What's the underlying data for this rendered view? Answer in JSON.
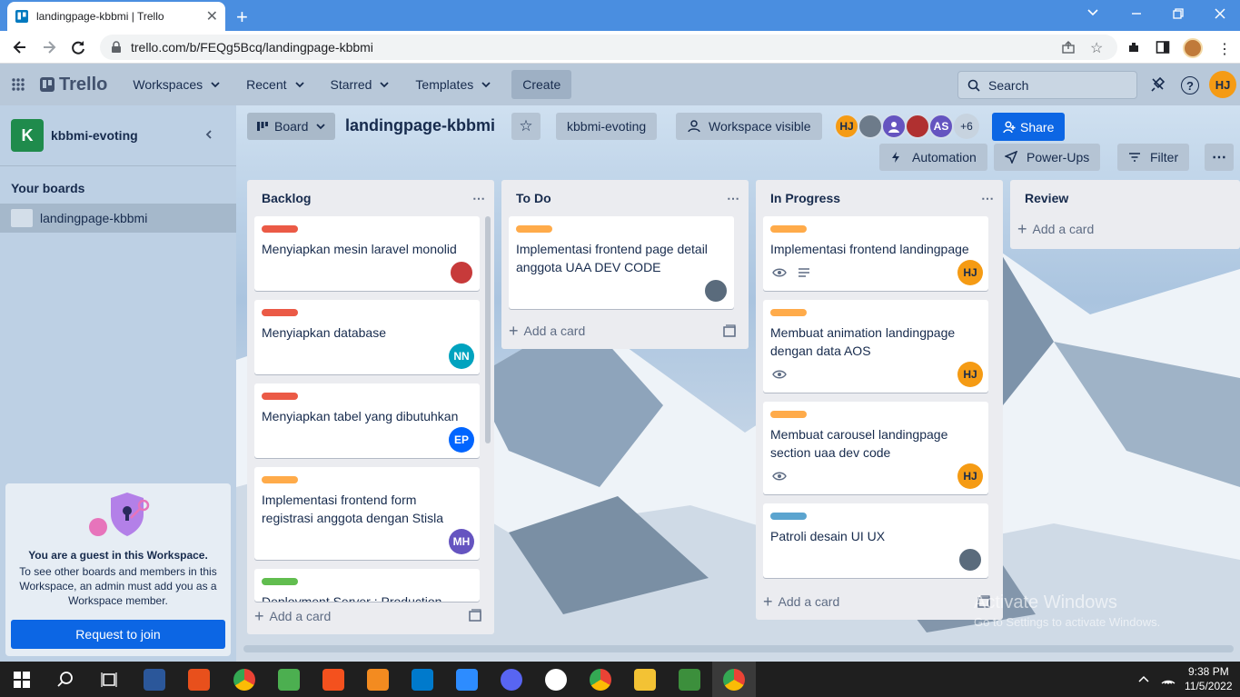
{
  "browser": {
    "tab_title": "landingpage-kbbmi | Trello",
    "url": "trello.com/b/FEQg5Bcq/landingpage-kbbmi"
  },
  "header": {
    "logo": "Trello",
    "menus": [
      "Workspaces",
      "Recent",
      "Starred",
      "Templates"
    ],
    "create": "Create",
    "search_placeholder": "Search",
    "user_initials": "HJ"
  },
  "sidebar": {
    "workspace_initial": "K",
    "workspace_name": "kbbmi-evoting",
    "your_boards": "Your boards",
    "board_item": "landingpage-kbbmi",
    "guest_title": "You are a guest in this Workspace.",
    "guest_text": "To see other boards and members in this Workspace, an admin must add you as a Workspace member.",
    "request_button": "Request to join"
  },
  "boardbar": {
    "view": "Board",
    "title": "landingpage-kbbmi",
    "workspace": "kbbmi-evoting",
    "visibility": "Workspace visible",
    "members": [
      "HJ",
      "AS"
    ],
    "more_members": "+6",
    "share": "Share",
    "automation": "Automation",
    "powerups": "Power-Ups",
    "filter": "Filter"
  },
  "lists": [
    {
      "title": "Backlog",
      "add": "Add a card",
      "cards": [
        {
          "text": "Menyiapkan mesin laravel monolid",
          "label": "#eb5a46",
          "member": "photo"
        },
        {
          "text": "Menyiapkan database",
          "label": "#eb5a46",
          "member": "NN"
        },
        {
          "text": "Menyiapkan tabel yang dibutuhkan",
          "label": "#eb5a46",
          "member": "EP"
        },
        {
          "text": "Implementasi frontend form registrasi anggota dengan Stisla",
          "label": "#ffab4a",
          "member": "MH"
        },
        {
          "text": "Deployment Server : Production",
          "label": "#61bd4f",
          "member": ""
        }
      ]
    },
    {
      "title": "To Do",
      "add": "Add a card",
      "cards": [
        {
          "text": "Implementasi frontend page detail anggota UAA DEV CODE",
          "label": "#ffab4a",
          "member": "photo"
        }
      ]
    },
    {
      "title": "In Progress",
      "add": "Add a card",
      "cards": [
        {
          "text": "Implementasi frontend landingpage",
          "label": "#ffab4a",
          "member": "HJ"
        },
        {
          "text": "Membuat animation landingpage dengan data AOS",
          "label": "#ffab4a",
          "member": "HJ"
        },
        {
          "text": "Membuat carousel landingpage section uaa dev code",
          "label": "#ffab4a",
          "member": "HJ"
        },
        {
          "text": "Patroli desain UI UX",
          "label": "#5ba4cf",
          "member": "photo"
        }
      ]
    },
    {
      "title": "Review",
      "add": "Add a card",
      "cards": []
    }
  ],
  "watermark": {
    "line1": "Activate Windows",
    "line2": "Go to Settings to activate Windows."
  },
  "taskbar": {
    "time": "9:38 PM",
    "date": "11/5/2022"
  },
  "colors": {
    "accent": "#0c66e4",
    "orange": "#f59b14",
    "teal": "#00a3bf",
    "blue": "#0065ff",
    "purple": "#6554c0"
  }
}
